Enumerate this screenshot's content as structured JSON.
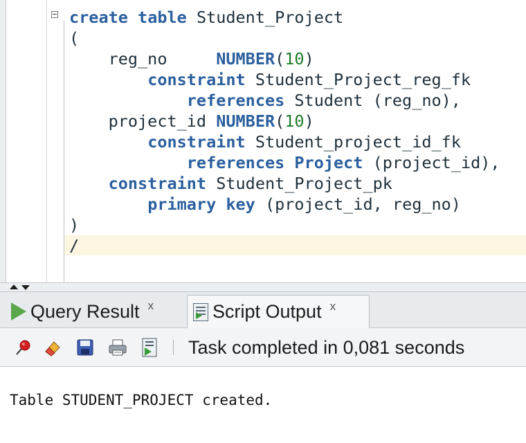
{
  "editor": {
    "lines": [
      [
        {
          "t": "create",
          "k": "kw"
        },
        {
          "t": " "
        },
        {
          "t": "table",
          "k": "kw"
        },
        {
          "t": " Student_Project"
        }
      ],
      [
        {
          "t": "("
        }
      ],
      [
        {
          "t": "    reg_no     "
        },
        {
          "t": "NUMBER",
          "k": "kw"
        },
        {
          "t": "("
        },
        {
          "t": "10",
          "k": "num"
        },
        {
          "t": ")"
        }
      ],
      [
        {
          "t": "        "
        },
        {
          "t": "constraint",
          "k": "kw"
        },
        {
          "t": " Student_Project_reg_fk"
        }
      ],
      [
        {
          "t": "            "
        },
        {
          "t": "references",
          "k": "kw"
        },
        {
          "t": " Student (reg_no),"
        }
      ],
      [
        {
          "t": "    project_id "
        },
        {
          "t": "NUMBER",
          "k": "kw"
        },
        {
          "t": "("
        },
        {
          "t": "10",
          "k": "num"
        },
        {
          "t": ")"
        }
      ],
      [
        {
          "t": "        "
        },
        {
          "t": "constraint",
          "k": "kw"
        },
        {
          "t": " Student_project_id_fk"
        }
      ],
      [
        {
          "t": "            "
        },
        {
          "t": "references",
          "k": "kw"
        },
        {
          "t": " "
        },
        {
          "t": "Project",
          "k": "kw"
        },
        {
          "t": " (project_id),"
        }
      ],
      [
        {
          "t": "    "
        },
        {
          "t": "constraint",
          "k": "kw"
        },
        {
          "t": " Student_Project_pk"
        }
      ],
      [
        {
          "t": "        "
        },
        {
          "t": "primary",
          "k": "kw"
        },
        {
          "t": " "
        },
        {
          "t": "key",
          "k": "kw"
        },
        {
          "t": " (project_id, reg_no)"
        }
      ],
      [
        {
          "t": ")"
        }
      ],
      [
        {
          "t": "/"
        }
      ]
    ]
  },
  "tabs": {
    "query_result": {
      "label": "Query Result",
      "close": "x"
    },
    "script_output": {
      "label": "Script Output",
      "close": "x"
    }
  },
  "toolbar": {
    "icons": [
      "pin-icon",
      "eraser-icon",
      "save-icon",
      "print-icon",
      "script-run-icon"
    ],
    "status": "Task completed in 0,081 seconds"
  },
  "output": {
    "text": "Table STUDENT_PROJECT created."
  },
  "colors": {
    "keyword": "#2b5f9e",
    "number": "#1e7a2a",
    "current_line": "#fdf6e3"
  }
}
